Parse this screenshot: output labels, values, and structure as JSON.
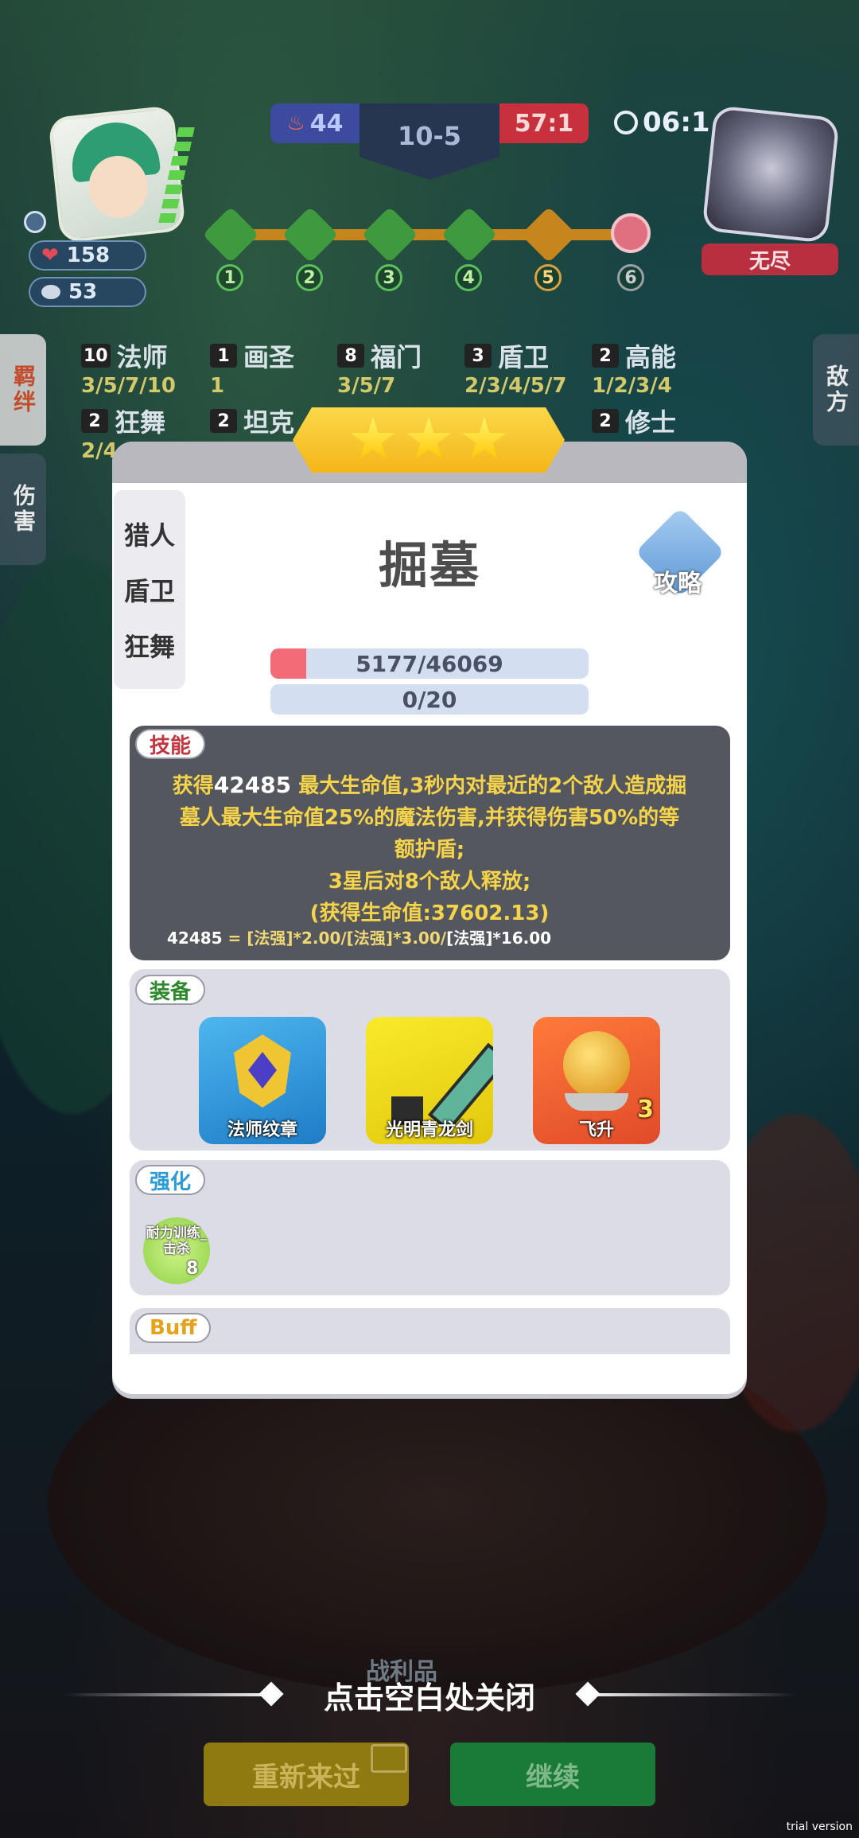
{
  "hud": {
    "player": {
      "hp": "158",
      "coins": "53"
    },
    "score_left": "44",
    "stage": "10-5",
    "score_right": "57:1",
    "timer": "06:1",
    "enemy_label": "无尽",
    "progress_nodes": [
      "1",
      "2",
      "3",
      "4",
      "5",
      "6"
    ]
  },
  "side_tabs": {
    "left_top": "羁绊",
    "left_bottom": "伤害",
    "right": "敌方"
  },
  "synergies": [
    {
      "count": "10",
      "name": "法师",
      "tiers": "3/5/7/10"
    },
    {
      "count": "1",
      "name": "画圣",
      "tiers": "1"
    },
    {
      "count": "8",
      "name": "福门",
      "tiers": "3/5/7"
    },
    {
      "count": "3",
      "name": "盾卫",
      "tiers": "2/3/4/5/7"
    },
    {
      "count": "2",
      "name": "高能",
      "tiers": "1/2/3/4"
    },
    {
      "count": "2",
      "name": "狂舞",
      "tiers": "2/4"
    },
    {
      "count": "2",
      "name": "坦克",
      "tiers": ""
    },
    {
      "count": "2",
      "name": "修士",
      "tiers": ""
    }
  ],
  "modal": {
    "stars": 3,
    "classes": [
      "猎人",
      "盾卫",
      "狂舞"
    ],
    "hero_name": "掘墓",
    "guide_label": "攻略",
    "hp_text": "5177/46069",
    "hp_fraction": 0.112,
    "energy_text": "0/20",
    "skill": {
      "label": "技能",
      "line1_a": "获得",
      "line1_num": "42485",
      "line1_b": " 最大生命值,3秒内对最近的2个敌人造成掘",
      "line2": "墓人最大生命值25%的魔法伤害,并获得伤害50%的等",
      "line3": "额护盾;",
      "line4": "3星后对8个敌人释放;",
      "line5": "(获得生命值:37602.13)",
      "formula_num": "42485",
      "formula_eq": " = ",
      "formula_a": "[法强]*2.00/[法强]*3.00/",
      "formula_b": "[法强]*16.00"
    },
    "equipment": {
      "label": "装备",
      "items": [
        {
          "name": "法师纹章",
          "icon": "mage-emblem-icon",
          "level": ""
        },
        {
          "name": "光明青龙剑",
          "icon": "pixel-sword-icon",
          "level": ""
        },
        {
          "name": "飞升",
          "icon": "ascension-orb-icon",
          "level": "3"
        }
      ]
    },
    "enhance": {
      "label": "强化",
      "item_name": "耐力训练_击杀",
      "item_level": "8"
    },
    "buff": {
      "label": "Buff"
    }
  },
  "bottom": {
    "close_hint": "点击空白处关闭",
    "spoils": "战利品",
    "retry": "重新来过",
    "continue": "继续",
    "watermark": "trial version"
  },
  "colors": {
    "gold": "#f4b619",
    "skill_text": "#f5d34a",
    "hp_fill": "#f26b77",
    "enemy_red": "#c8303d",
    "team_blue": "#3c4aa0"
  }
}
